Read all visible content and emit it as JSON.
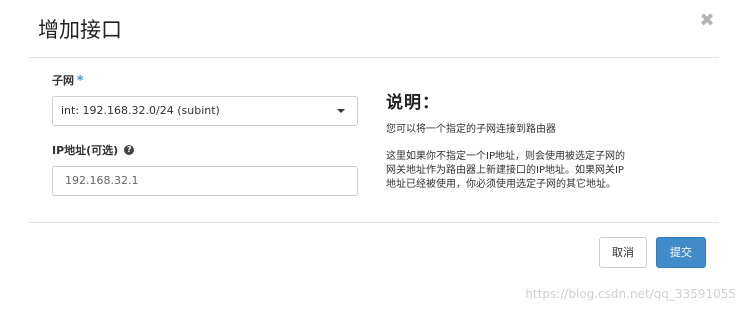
{
  "dialog": {
    "title": "增加接口",
    "close_icon": "close-icon"
  },
  "form": {
    "subnet_label": "子网",
    "subnet_required_mark": "*",
    "subnet_value": "int: 192.168.32.0/24 (subint)",
    "ip_label": "IP地址(可选)",
    "ip_help_icon": "?",
    "ip_value": "192.168.32.1"
  },
  "help": {
    "title": "说明：",
    "paragraph1": "您可以将一个指定的子网连接到路由器",
    "paragraph2_lines": [
      "这里如果你不指定一个IP地址，则会使用被选定子网的",
      "网关地址作为路由器上新建接口的IP地址。如果网关IP",
      "地址已经被使用，你必须使用选定子网的其它地址。"
    ]
  },
  "footer": {
    "cancel_label": "取消",
    "submit_label": "提交"
  },
  "watermark": "https://blog.csdn.net/qq_33591055",
  "colors": {
    "primary": "#428bca",
    "required": "#428bca"
  }
}
